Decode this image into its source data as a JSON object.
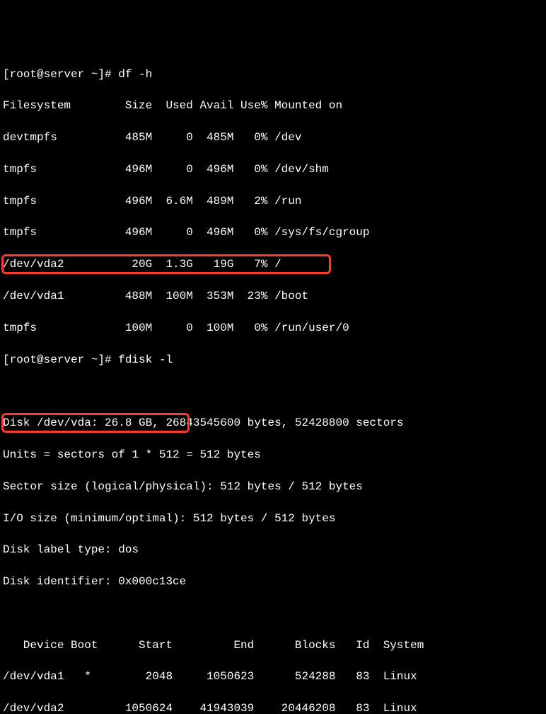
{
  "prompt1": "[root@server ~]# df -h",
  "df_header": "Filesystem        Size  Used Avail Use% Mounted on",
  "df_rows": [
    "devtmpfs          485M     0  485M   0% /dev",
    "tmpfs             496M     0  496M   0% /dev/shm",
    "tmpfs             496M  6.6M  489M   2% /run",
    "tmpfs             496M     0  496M   0% /sys/fs/cgroup",
    "/dev/vda2          20G  1.3G   19G   7% /",
    "/dev/vda1         488M  100M  353M  23% /boot",
    "tmpfs             100M     0  100M   0% /run/user/0"
  ],
  "prompt2": "[root@server ~]# fdisk -l",
  "fdisk": {
    "disk_line_a": "Disk /dev/vda: 26.8 GB,",
    "disk_line_b": " 26843545600 bytes, 52428800 sectors",
    "units": "Units = sectors of 1 * 512 = 512 bytes",
    "sector_size": "Sector size (logical/physical): 512 bytes / 512 bytes",
    "io_size": "I/O size (minimum/optimal): 512 bytes / 512 bytes",
    "label": "Disk label type: dos",
    "identifier": "Disk identifier: 0x000c13ce"
  },
  "part_header": "   Device Boot      Start         End      Blocks   Id  System",
  "part_rows": [
    "/dev/vda1   *        2048     1050623      524288   83  Linux",
    "/dev/vda2         1050624    41943039    20446208   83  Linux"
  ],
  "chart_data": [
    {
      "type": "table",
      "title": "df -h",
      "headers": [
        "Filesystem",
        "Size",
        "Used",
        "Avail",
        "Use%",
        "Mounted on"
      ],
      "rows": [
        [
          "devtmpfs",
          "485M",
          "0",
          "485M",
          "0%",
          "/dev"
        ],
        [
          "tmpfs",
          "496M",
          "0",
          "496M",
          "0%",
          "/dev/shm"
        ],
        [
          "tmpfs",
          "496M",
          "6.6M",
          "489M",
          "2%",
          "/run"
        ],
        [
          "tmpfs",
          "496M",
          "0",
          "496M",
          "0%",
          "/sys/fs/cgroup"
        ],
        [
          "/dev/vda2",
          "20G",
          "1.3G",
          "19G",
          "7%",
          "/"
        ],
        [
          "/dev/vda1",
          "488M",
          "100M",
          "353M",
          "23%",
          "/boot"
        ],
        [
          "tmpfs",
          "100M",
          "0",
          "100M",
          "0%",
          "/run/user/0"
        ]
      ]
    },
    {
      "type": "table",
      "title": "fdisk -l partitions",
      "headers": [
        "Device",
        "Boot",
        "Start",
        "End",
        "Blocks",
        "Id",
        "System"
      ],
      "rows": [
        [
          "/dev/vda1",
          "*",
          "2048",
          "1050623",
          "524288",
          "83",
          "Linux"
        ],
        [
          "/dev/vda2",
          "",
          "1050624",
          "41943039",
          "20446208",
          "83",
          "Linux"
        ]
      ]
    }
  ]
}
